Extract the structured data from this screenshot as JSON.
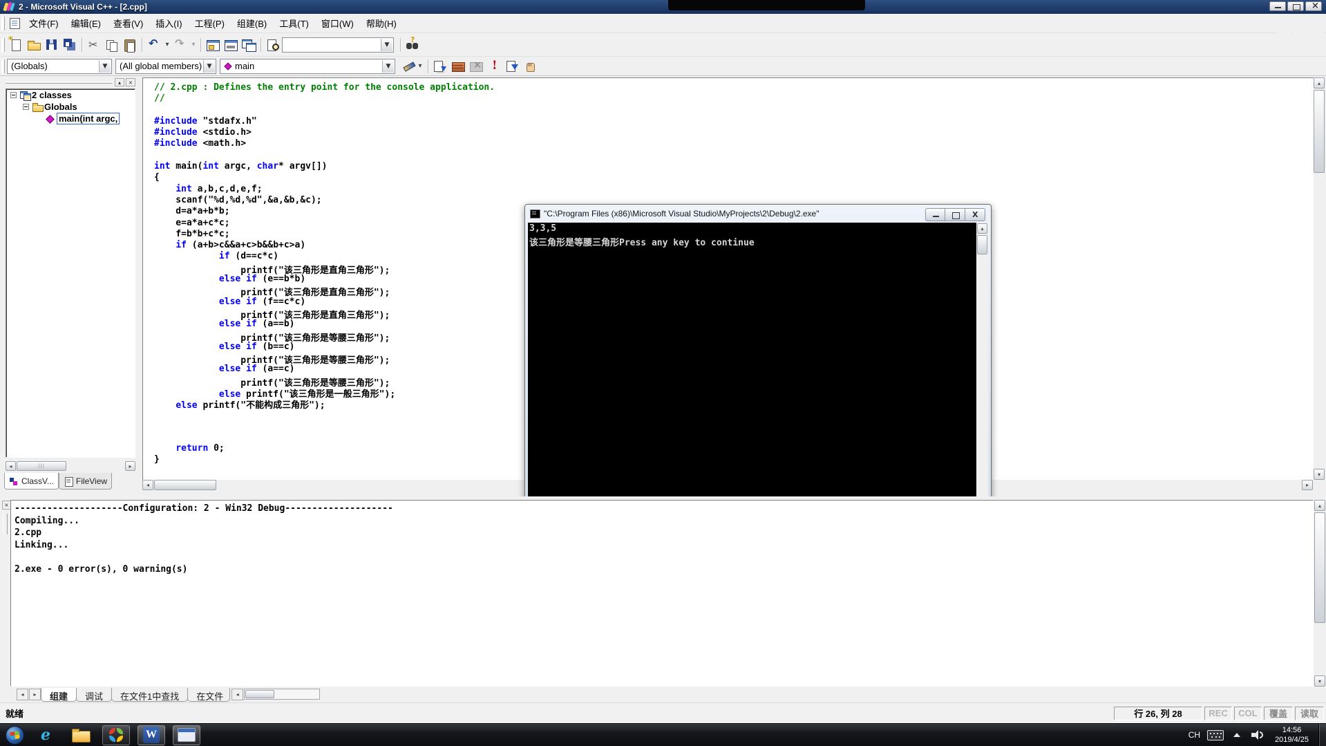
{
  "titlebar": {
    "title": "2 - Microsoft Visual C++ - [2.cpp]"
  },
  "menubar": {
    "items": [
      "文件(F)",
      "编辑(E)",
      "查看(V)",
      "插入(I)",
      "工程(P)",
      "组建(B)",
      "工具(T)",
      "窗口(W)",
      "帮助(H)"
    ]
  },
  "toolbar": {
    "icons": [
      "new-file",
      "open",
      "save",
      "save-all",
      "|",
      "cut",
      "copy",
      "paste",
      "|",
      "undo",
      "redo",
      "|",
      "workspace-window",
      "output-window",
      "cascade-windows",
      "|",
      "find-in-files",
      "find-combo",
      "|",
      "search"
    ],
    "find_value": ""
  },
  "wizardbar": {
    "class_combo": "(Globals)",
    "members_combo": "(All global members)",
    "member_combo": "main",
    "build_icons": [
      "compile",
      "build",
      "stop-build",
      "execute-program",
      "go",
      "breakpoint-hand"
    ]
  },
  "workspace": {
    "tree": [
      {
        "label": "2 classes",
        "level": 0,
        "icon": "classes-icon",
        "expander": true,
        "selected": false
      },
      {
        "label": "Globals",
        "level": 1,
        "icon": "folder-icon",
        "expander": true,
        "selected": false
      },
      {
        "label": "main(int argc,",
        "level": 2,
        "icon": "member-diamond-icon",
        "expander": false,
        "selected": true
      }
    ],
    "tabs": [
      {
        "label": "ClassV...",
        "icon": "classview-tab-icon",
        "active": true
      },
      {
        "label": "FileView",
        "icon": "fileview-tab-icon",
        "active": false
      }
    ]
  },
  "editor": {
    "lines": [
      [
        [
          "cm",
          "// 2.cpp : Defines the entry point for the console application."
        ]
      ],
      [
        [
          "cm",
          "//"
        ]
      ],
      [],
      [
        [
          "kw",
          "#include"
        ],
        [
          "pl",
          " \"stdafx.h\""
        ]
      ],
      [
        [
          "kw",
          "#include"
        ],
        [
          "pl",
          " <stdio.h>"
        ]
      ],
      [
        [
          "kw",
          "#include"
        ],
        [
          "pl",
          " <math.h>"
        ]
      ],
      [],
      [
        [
          "kw",
          "int"
        ],
        [
          "pl",
          " main("
        ],
        [
          "kw",
          "int"
        ],
        [
          "pl",
          " argc, "
        ],
        [
          "kw",
          "char"
        ],
        [
          "pl",
          "* argv[])"
        ]
      ],
      [
        [
          "pl",
          "{"
        ]
      ],
      [
        [
          "pl",
          "    "
        ],
        [
          "kw",
          "int"
        ],
        [
          "pl",
          " a,b,c,d,e,f;"
        ]
      ],
      [
        [
          "pl",
          "    scanf(\"%d,%d,%d\",&a,&b,&c);"
        ]
      ],
      [
        [
          "pl",
          "    d=a*a+b*b;"
        ]
      ],
      [
        [
          "pl",
          "    e=a*a+c*c;"
        ]
      ],
      [
        [
          "pl",
          "    f=b*b+c*c;"
        ]
      ],
      [
        [
          "pl",
          "    "
        ],
        [
          "kw",
          "if"
        ],
        [
          "pl",
          " (a+b>c&&a+c>b&&b+c>a)"
        ]
      ],
      [
        [
          "pl",
          "            "
        ],
        [
          "kw",
          "if"
        ],
        [
          "pl",
          " (d==c*c)"
        ]
      ],
      [
        [
          "pl",
          "                printf(\"该三角形是直角三角形\");"
        ]
      ],
      [
        [
          "pl",
          "            "
        ],
        [
          "kw",
          "else"
        ],
        [
          "pl",
          " "
        ],
        [
          "kw",
          "if"
        ],
        [
          "pl",
          " (e==b*b)"
        ]
      ],
      [
        [
          "pl",
          "                printf(\"该三角形是直角三角形\");"
        ]
      ],
      [
        [
          "pl",
          "            "
        ],
        [
          "kw",
          "else"
        ],
        [
          "pl",
          " "
        ],
        [
          "kw",
          "if"
        ],
        [
          "pl",
          " (f==c*c)"
        ]
      ],
      [
        [
          "pl",
          "                printf(\"该三角形是直角三角形\");"
        ]
      ],
      [
        [
          "pl",
          "            "
        ],
        [
          "kw",
          "else"
        ],
        [
          "pl",
          " "
        ],
        [
          "kw",
          "if"
        ],
        [
          "pl",
          " (a==b)"
        ]
      ],
      [
        [
          "pl",
          "                printf(\"该三角形是等腰三角形\");"
        ]
      ],
      [
        [
          "pl",
          "            "
        ],
        [
          "kw",
          "else"
        ],
        [
          "pl",
          " "
        ],
        [
          "kw",
          "if"
        ],
        [
          "pl",
          " (b==c)"
        ]
      ],
      [
        [
          "pl",
          "                printf(\"该三角形是等腰三角形\");"
        ]
      ],
      [
        [
          "pl",
          "            "
        ],
        [
          "kw",
          "else"
        ],
        [
          "pl",
          " "
        ],
        [
          "kw",
          "if"
        ],
        [
          "pl",
          " (a==c)"
        ]
      ],
      [
        [
          "pl",
          "                printf(\"该三角形是等腰三角形\");"
        ]
      ],
      [
        [
          "pl",
          "            "
        ],
        [
          "kw",
          "else"
        ],
        [
          "pl",
          " printf(\"该三角形是一般三角形\");"
        ]
      ],
      [
        [
          "pl",
          "    "
        ],
        [
          "kw",
          "else"
        ],
        [
          "pl",
          " printf(\"不能构成三角形\");"
        ]
      ],
      [],
      [],
      [],
      [
        [
          "pl",
          "    "
        ],
        [
          "kw",
          "return"
        ],
        [
          "pl",
          " 0;"
        ]
      ],
      [
        [
          "pl",
          "}"
        ]
      ]
    ]
  },
  "console": {
    "title": "\"C:\\Program Files (x86)\\Microsoft Visual Studio\\MyProjects\\2\\Debug\\2.exe\"",
    "lines": [
      "3,3,5",
      "该三角形是等腰三角形Press any key to continue"
    ]
  },
  "output": {
    "lines": [
      "--------------------Configuration: 2 - Win32 Debug--------------------",
      "Compiling...",
      "2.cpp",
      "Linking...",
      "",
      "2.exe - 0 error(s), 0 warning(s)"
    ],
    "tabs": [
      {
        "label": "组建",
        "active": true
      },
      {
        "label": "调试",
        "active": false
      },
      {
        "label": "在文件1中查找",
        "active": false
      },
      {
        "label": "在文件",
        "active": false
      }
    ]
  },
  "statusbar": {
    "message": "就绪",
    "position": "行 26, 列 28",
    "indicators": [
      {
        "label": "REC",
        "state": "dim"
      },
      {
        "label": "COL",
        "state": "dim"
      },
      {
        "label": "覆盖",
        "state": "mid"
      },
      {
        "label": "读取",
        "state": "mid"
      }
    ]
  },
  "taskbar": {
    "language": "CH",
    "time": "14:56",
    "date": "2019/4/25",
    "colors": {
      "titlebar": "#16305c",
      "keyword": "#0000ff",
      "comment": "#008000",
      "diamond": "#d018c8"
    }
  }
}
